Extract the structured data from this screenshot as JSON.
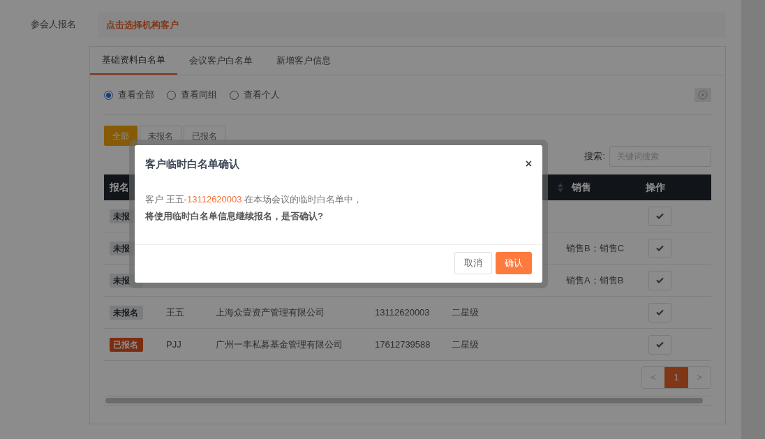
{
  "field_label": "参会人报名",
  "select_org_button": "点击选择机构客户",
  "tabs": [
    {
      "label": "基础资料白名单",
      "selected": true
    },
    {
      "label": "会议客户白名单",
      "selected": false
    },
    {
      "label": "新增客户信息",
      "selected": false
    }
  ],
  "scope_radios": [
    {
      "label": "查看全部",
      "selected": true
    },
    {
      "label": "查看同组",
      "selected": false
    },
    {
      "label": "查看个人",
      "selected": false
    }
  ],
  "status_filters": [
    {
      "label": "全部",
      "selected": true
    },
    {
      "label": "未报名",
      "selected": false
    },
    {
      "label": "已报名",
      "selected": false
    }
  ],
  "search": {
    "label": "搜索:",
    "placeholder": "关键词搜索"
  },
  "table": {
    "columns": [
      "报名",
      "",
      "",
      "",
      "",
      "销售",
      "操作"
    ],
    "rows": [
      {
        "status": "未报",
        "registered": false,
        "name": "",
        "company": "",
        "phone": "",
        "level": "",
        "sales": ""
      },
      {
        "status": "未报",
        "registered": false,
        "name": "",
        "company": "",
        "phone": "",
        "level": "",
        "sales": "销售B；销售C"
      },
      {
        "status": "未报",
        "registered": false,
        "name": "",
        "company": "",
        "phone": "",
        "level": "",
        "sales": "销售A；销售B"
      },
      {
        "status": "未报名",
        "registered": false,
        "name": "王五",
        "company": "上海众壹资产管理有限公司",
        "phone": "13112620003",
        "level": "二星级",
        "sales": ""
      },
      {
        "status": "已报名",
        "registered": true,
        "name": "PJJ",
        "company": "广州一丰私募基金管理有限公司",
        "phone": "17612739588",
        "level": "二星级",
        "sales": ""
      }
    ]
  },
  "pagination": {
    "prev": "<",
    "pages": [
      {
        "label": "1",
        "selected": true
      }
    ],
    "next": ">"
  },
  "dialog": {
    "title": "客户临时白名单确认",
    "close": "×",
    "message_prefix": "客户 王五-",
    "message_phone": "13112620003",
    "message_suffix": " 在本场会议的临时白名单中，",
    "message_line2": "将使用临时白名单信息继续报名，是否确认?",
    "cancel": "取消",
    "confirm": "确认"
  }
}
